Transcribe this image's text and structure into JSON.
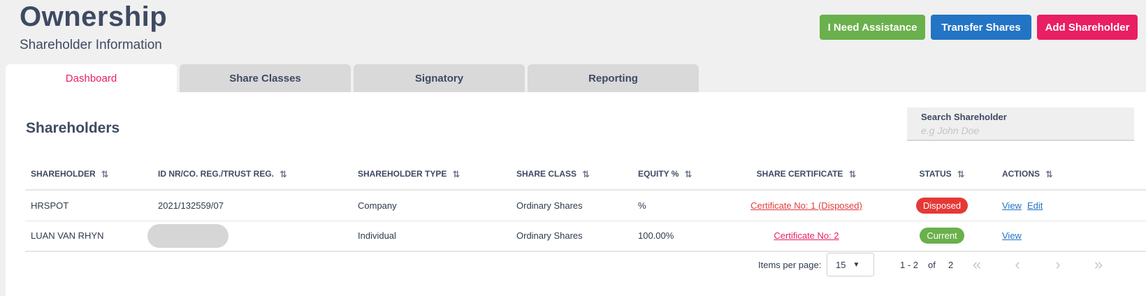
{
  "header": {
    "title": "Ownership",
    "subtitle": "Shareholder Information",
    "buttons": {
      "assistance": "I Need Assistance",
      "transfer": "Transfer Shares",
      "add": "Add Shareholder"
    }
  },
  "tabs": [
    {
      "label": "Dashboard",
      "active": true
    },
    {
      "label": "Share Classes",
      "active": false
    },
    {
      "label": "Signatory",
      "active": false
    },
    {
      "label": "Reporting",
      "active": false
    }
  ],
  "section": {
    "title": "Shareholders"
  },
  "search": {
    "label": "Search Shareholder",
    "placeholder": "e.g John Doe",
    "value": ""
  },
  "table": {
    "columns": [
      "SHAREHOLDER",
      "ID NR/CO. REG./TRUST REG.",
      "SHAREHOLDER TYPE",
      "SHARE CLASS",
      "EQUITY %",
      "SHARE CERTIFICATE",
      "STATUS",
      "ACTIONS"
    ],
    "rows": [
      {
        "shareholder": "HRSPOT",
        "id_nr": "2021/132559/07",
        "type": "Company",
        "share_class": "Ordinary Shares",
        "equity": "%",
        "certificate": "Certificate No: 1 (Disposed)",
        "status": "Disposed",
        "actions": [
          "View",
          "Edit"
        ]
      },
      {
        "shareholder": "LUAN VAN RHYN",
        "id_nr": "",
        "type": "Individual",
        "share_class": "Ordinary Shares",
        "equity": "100.00%",
        "certificate": "Certificate No: 2",
        "status": "Current",
        "actions": [
          "View"
        ]
      }
    ]
  },
  "pagination": {
    "items_per_page_label": "Items per page:",
    "items_per_page": "15",
    "range": "1 - 2",
    "of_label": "of",
    "total": "2"
  },
  "colors": {
    "assist_button": "#6ab04c",
    "transfer_button": "#2374c4",
    "add_button": "#e91e63",
    "active_tab": "#e91e63",
    "status_disposed": "#e53935",
    "status_current": "#6ab04c"
  }
}
